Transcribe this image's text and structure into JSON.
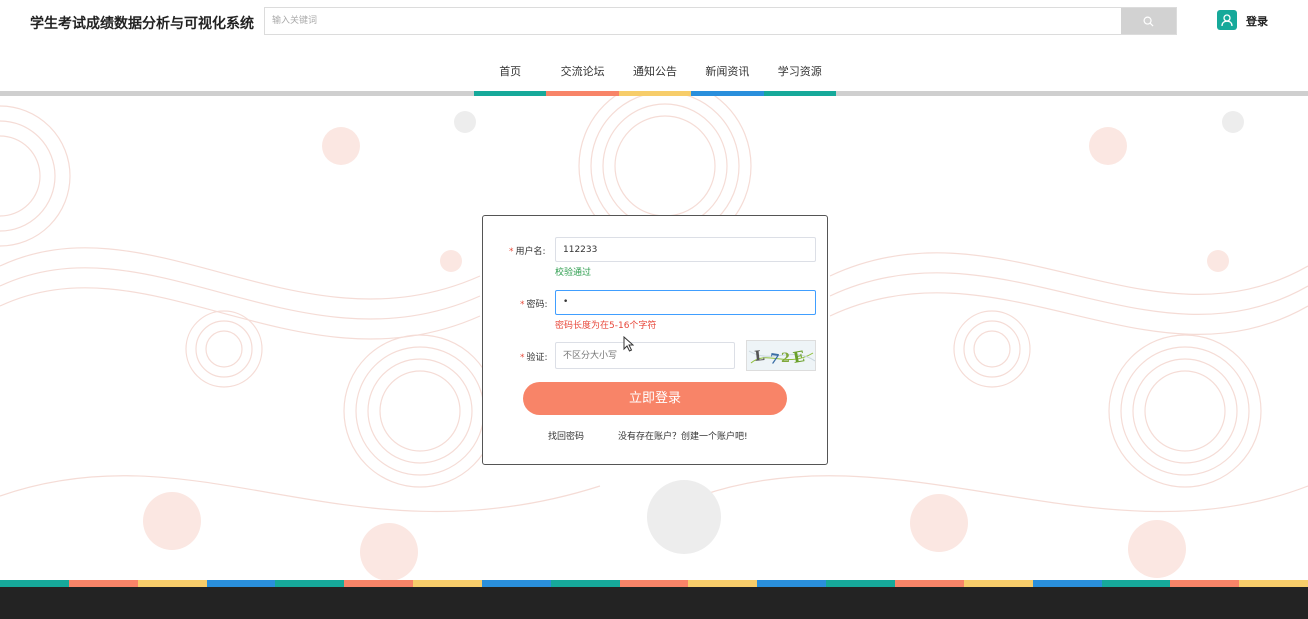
{
  "app": {
    "title": "学生考试成绩数据分析与可视化系统"
  },
  "search": {
    "placeholder": "输入关键词",
    "icon": "search-icon"
  },
  "user": {
    "login_label": "登录",
    "icon": "user-icon"
  },
  "nav": {
    "items": [
      {
        "label": "首页"
      },
      {
        "label": "交流论坛"
      },
      {
        "label": "通知公告"
      },
      {
        "label": "新闻资讯"
      },
      {
        "label": "学习资源"
      }
    ]
  },
  "form": {
    "username": {
      "label": "用户名:",
      "value": "112233",
      "validation": "校验通过"
    },
    "password": {
      "label": "密码:",
      "value": "•",
      "error": "密码长度为在5-16个字符"
    },
    "captcha": {
      "label": "验证:",
      "placeholder": "不区分大小写",
      "code": "L72E"
    },
    "submit_label": "立即登录",
    "forgot_label": "找回密码",
    "register_label": "没有存在账户？创建一个账户吧!"
  },
  "colors": {
    "teal": "#16a99a",
    "coral": "#f88468",
    "yellow": "#f7cd6a",
    "blue": "#2a8fdc",
    "footer": "#232323"
  }
}
